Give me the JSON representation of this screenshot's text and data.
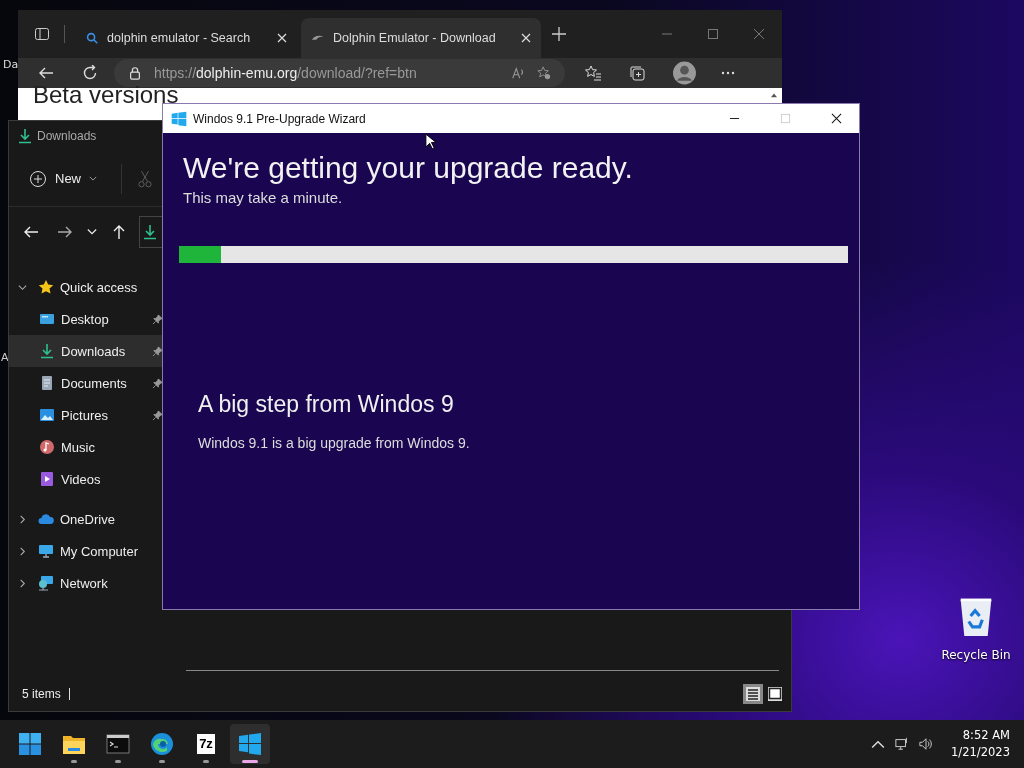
{
  "desktop": {
    "edge_labels": [
      "Da",
      "A"
    ],
    "icons": [
      {
        "label": "Recycle Bin",
        "kind": "recycle"
      }
    ]
  },
  "browser": {
    "tabs": [
      {
        "title": "dolphin emulator - Search",
        "kind": "search",
        "selected": false
      },
      {
        "title": "Dolphin Emulator - Download",
        "kind": "dolphin",
        "selected": true
      }
    ],
    "address": {
      "scheme": "https://",
      "domain": "dolphin-emu.org",
      "path": "/download/?ref=btn"
    },
    "page_heading": "Beta versions"
  },
  "explorer": {
    "title": "Downloads",
    "new_button": "New",
    "sidebar": [
      {
        "label": "Quick access",
        "kind": "star",
        "expanded": true,
        "selected": false,
        "children": [
          {
            "label": "Desktop",
            "kind": "desktop",
            "pinned": true,
            "selected": false
          },
          {
            "label": "Downloads",
            "kind": "download",
            "pinned": true,
            "selected": true
          },
          {
            "label": "Documents",
            "kind": "document",
            "pinned": true,
            "selected": false
          },
          {
            "label": "Pictures",
            "kind": "picture",
            "pinned": true,
            "selected": false
          },
          {
            "label": "Music",
            "kind": "music",
            "pinned": false,
            "selected": false
          },
          {
            "label": "Videos",
            "kind": "video",
            "pinned": false,
            "selected": false
          }
        ]
      },
      {
        "label": "OneDrive",
        "kind": "cloud",
        "expanded": false,
        "selected": false
      },
      {
        "label": "My Computer",
        "kind": "computer",
        "expanded": false,
        "selected": false
      },
      {
        "label": "Network",
        "kind": "network",
        "expanded": false,
        "selected": false
      }
    ],
    "status": "5 items",
    "views": [
      {
        "kind": "details",
        "selected": true
      },
      {
        "kind": "tiles",
        "selected": false
      }
    ]
  },
  "wizard": {
    "title": "Windos 9.1 Pre-Upgrade Wizard",
    "heading": "We're getting your upgrade ready.",
    "subheading": "This may take a minute.",
    "progress": {
      "level": 0.063
    },
    "section_title": "A big step from Windos 9",
    "section_text": "Windos 9.1 is a big upgrade from Windos 9."
  },
  "taskbar": {
    "apps": [
      {
        "kind": "start",
        "running": false,
        "active": false
      },
      {
        "kind": "folder",
        "running": true,
        "active": false
      },
      {
        "kind": "terminal",
        "running": true,
        "active": false
      },
      {
        "kind": "edge",
        "running": true,
        "active": false
      },
      {
        "kind": "archive",
        "label": "7z",
        "running": true,
        "active": false
      },
      {
        "kind": "windos",
        "running": true,
        "active": true
      }
    ],
    "time": "8:52 AM",
    "date": "1/21/2023"
  }
}
